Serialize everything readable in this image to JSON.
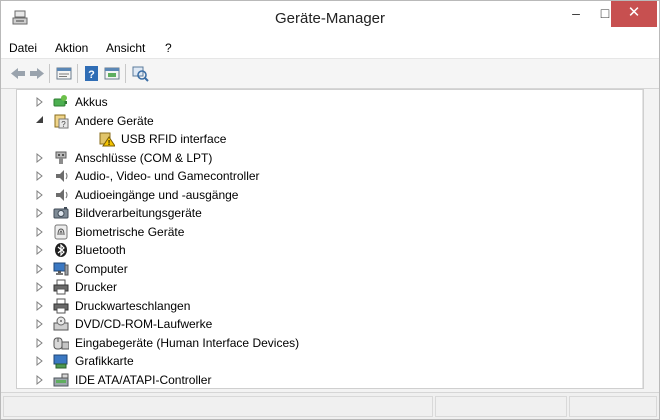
{
  "window": {
    "title": "Geräte-Manager",
    "close_glyph": "✕",
    "min_glyph": "–",
    "max_glyph": "□"
  },
  "menu": [
    "Datei",
    "Aktion",
    "Ansicht",
    "?"
  ],
  "toolbar": {
    "buttons": [
      "back-icon",
      "forward-icon",
      "properties-icon",
      "help-icon",
      "update-driver-icon",
      "scan-hardware-icon"
    ]
  },
  "tree": {
    "items": [
      {
        "label": "Akkus",
        "icon": "battery-icon",
        "expander": "collapsed",
        "level": 0
      },
      {
        "label": "Andere Geräte",
        "icon": "other-devices-icon",
        "expander": "expanded",
        "level": 0
      },
      {
        "label": "USB RFID interface",
        "icon": "warning-device-icon",
        "expander": "none",
        "level": 1
      },
      {
        "label": "Anschlüsse (COM & LPT)",
        "icon": "port-icon",
        "expander": "collapsed",
        "level": 0
      },
      {
        "label": "Audio-, Video- und Gamecontroller",
        "icon": "speaker-icon",
        "expander": "collapsed",
        "level": 0
      },
      {
        "label": "Audioeingänge und -ausgänge",
        "icon": "speaker-icon",
        "expander": "collapsed",
        "level": 0
      },
      {
        "label": "Bildverarbeitungsgeräte",
        "icon": "camera-icon",
        "expander": "collapsed",
        "level": 0
      },
      {
        "label": "Biometrische Geräte",
        "icon": "fingerprint-icon",
        "expander": "collapsed",
        "level": 0
      },
      {
        "label": "Bluetooth",
        "icon": "bluetooth-icon",
        "expander": "collapsed",
        "level": 0
      },
      {
        "label": "Computer",
        "icon": "computer-icon",
        "expander": "collapsed",
        "level": 0
      },
      {
        "label": "Drucker",
        "icon": "printer-icon",
        "expander": "collapsed",
        "level": 0
      },
      {
        "label": "Druckwarteschlangen",
        "icon": "printer-icon",
        "expander": "collapsed",
        "level": 0
      },
      {
        "label": "DVD/CD-ROM-Laufwerke",
        "icon": "optical-drive-icon",
        "expander": "collapsed",
        "level": 0
      },
      {
        "label": "Eingabegeräte (Human Interface Devices)",
        "icon": "hid-icon",
        "expander": "collapsed",
        "level": 0
      },
      {
        "label": "Grafikkarte",
        "icon": "display-adapter-icon",
        "expander": "collapsed",
        "level": 0
      },
      {
        "label": "IDE ATA/ATAPI-Controller",
        "icon": "ide-controller-icon",
        "expander": "collapsed",
        "level": 0
      }
    ]
  },
  "scrollbar": {
    "up_glyph": "^",
    "down_glyph": "v",
    "position": 0.0
  },
  "colors": {
    "close_button": "#c75050",
    "selection": "#cce8ff",
    "window_bg": "#f3f3f3"
  }
}
